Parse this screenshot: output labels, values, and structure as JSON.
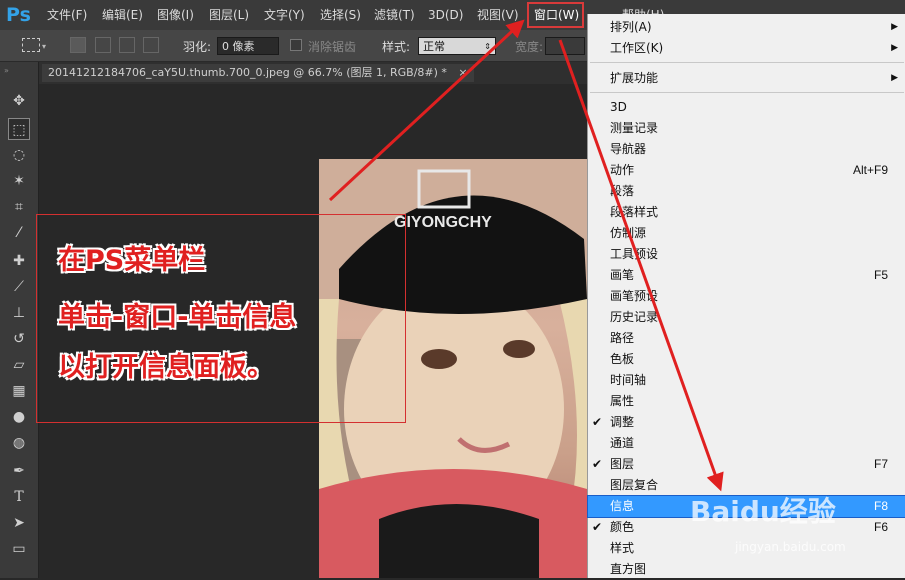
{
  "app": {
    "logo": "Ps"
  },
  "menubar": {
    "items": [
      {
        "label": "文件(F)"
      },
      {
        "label": "编辑(E)"
      },
      {
        "label": "图像(I)"
      },
      {
        "label": "图层(L)"
      },
      {
        "label": "文字(Y)"
      },
      {
        "label": "选择(S)"
      },
      {
        "label": "滤镜(T)"
      },
      {
        "label": "3D(D)"
      },
      {
        "label": "视图(V)"
      },
      {
        "label": "窗口(W)"
      },
      {
        "label": "帮助(H)"
      }
    ]
  },
  "options": {
    "feather_label": "羽化:",
    "feather_value": "0 像素",
    "antialias_label": "消除锯齿",
    "style_label": "样式:",
    "style_value": "正常",
    "width_label": "宽度:"
  },
  "document": {
    "tab_title": "20141212184706_caY5U.thumb.700_0.jpeg @ 66.7% (图层 1, RGB/8#) *",
    "close": "×"
  },
  "photo": {
    "hat_text": "GIYONGCHY"
  },
  "annotation": {
    "lines": [
      "在PS菜单栏",
      "单击-窗口-单击信息",
      "以打开信息面板。"
    ],
    "color": "#e02020"
  },
  "dropdown": {
    "items": [
      {
        "label": "排列(A)",
        "submenu": true
      },
      {
        "label": "工作区(K)",
        "submenu": true
      },
      {
        "label": "扩展功能",
        "submenu": true
      },
      {
        "label": "3D"
      },
      {
        "label": "测量记录"
      },
      {
        "label": "导航器"
      },
      {
        "label": "动作",
        "shortcut": "Alt+F9"
      },
      {
        "label": "段落"
      },
      {
        "label": "段落样式"
      },
      {
        "label": "仿制源"
      },
      {
        "label": "工具预设"
      },
      {
        "label": "画笔",
        "shortcut": "F5"
      },
      {
        "label": "画笔预设"
      },
      {
        "label": "历史记录"
      },
      {
        "label": "路径"
      },
      {
        "label": "色板"
      },
      {
        "label": "时间轴"
      },
      {
        "label": "属性"
      },
      {
        "label": "调整",
        "checked": true
      },
      {
        "label": "通道"
      },
      {
        "label": "图层",
        "shortcut": "F7",
        "checked": true
      },
      {
        "label": "图层复合"
      },
      {
        "label": "信息",
        "shortcut": "F8",
        "highlighted": true
      },
      {
        "label": "颜色",
        "shortcut": "F6",
        "checked": true
      },
      {
        "label": "样式"
      },
      {
        "label": "直方图"
      }
    ]
  },
  "watermark": {
    "text": "Baidu经验",
    "sub": "jingyan.baidu.com"
  },
  "colors": {
    "accent": "#33a2e8",
    "highlight": "#3399ff",
    "arrow": "#e02020"
  }
}
